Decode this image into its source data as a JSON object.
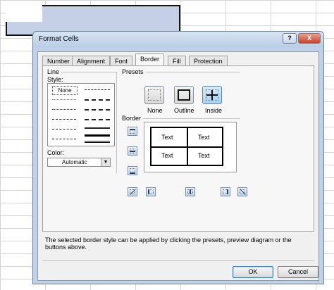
{
  "dialog": {
    "title": "Format Cells",
    "help": "?",
    "close": "X"
  },
  "tabs": [
    "Number",
    "Alignment",
    "Font",
    "Border",
    "Fill",
    "Protection"
  ],
  "active_tab": "Border",
  "line": {
    "group_label": "Line",
    "style_label": "Style:",
    "none_label": "None",
    "color_label": "Color:",
    "color_value": "Automatic"
  },
  "presets": {
    "group_label": "Presets",
    "items": [
      "None",
      "Outline",
      "Inside"
    ],
    "selected": "Inside"
  },
  "border": {
    "group_label": "Border",
    "preview_text": [
      "Text",
      "Text",
      "Text",
      "Text"
    ]
  },
  "description": "The selected border style can be applied by clicking the presets, preview diagram or the buttons above.",
  "buttons": {
    "ok": "OK",
    "cancel": "Cancel"
  },
  "colors": {
    "title_bar": "#bfd1e8",
    "selected_range": "#c5d0e6",
    "selected_preset": "#a9d1f1"
  }
}
